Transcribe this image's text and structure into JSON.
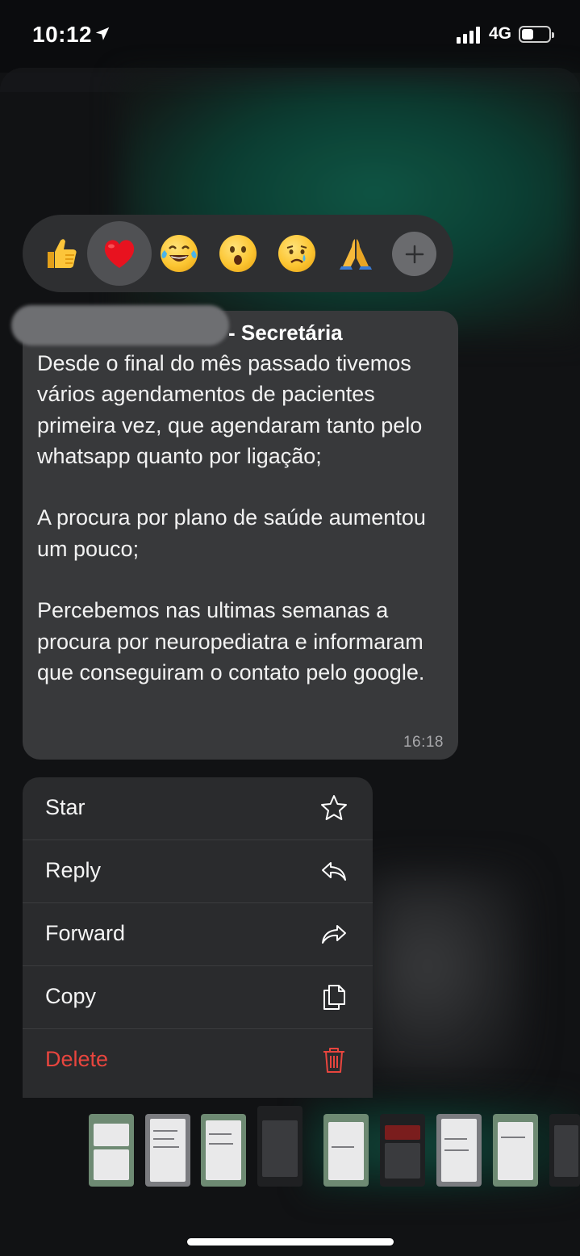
{
  "status_bar": {
    "time": "10:12",
    "network": "4G",
    "battery_level": 0.35
  },
  "reactions": {
    "items": [
      {
        "name": "thumbs-up",
        "selected": false
      },
      {
        "name": "red-heart",
        "selected": true
      },
      {
        "name": "tears-of-joy",
        "selected": false
      },
      {
        "name": "surprised",
        "selected": false
      },
      {
        "name": "crying",
        "selected": false
      },
      {
        "name": "folded-hands",
        "selected": false
      }
    ],
    "add_icon": "plus-icon"
  },
  "message": {
    "sender_suffix": "- Secretária",
    "body": "Desde o final do mês passado tivemos vários agendamentos de pacientes primeira vez, que agendaram tanto pelo whatsapp quanto por ligação;\n\nA procura por plano de saúde aumentou um pouco;\n\nPercebemos nas ultimas semanas a procura por neuropediatra e informaram que conseguiram o contato pelo google.",
    "time": "16:18"
  },
  "menu": {
    "items": [
      {
        "label": "Star",
        "icon": "star-icon"
      },
      {
        "label": "Reply",
        "icon": "reply-icon"
      },
      {
        "label": "Forward",
        "icon": "forward-icon"
      },
      {
        "label": "Copy",
        "icon": "copy-icon"
      },
      {
        "label": "Delete",
        "icon": "trash-icon"
      }
    ],
    "danger_color": "#e8453e"
  },
  "colors": {
    "bubble": "#38393b",
    "menu": "#2a2b2d",
    "reaction_bar": "#2e2f31",
    "background": "#111214"
  }
}
